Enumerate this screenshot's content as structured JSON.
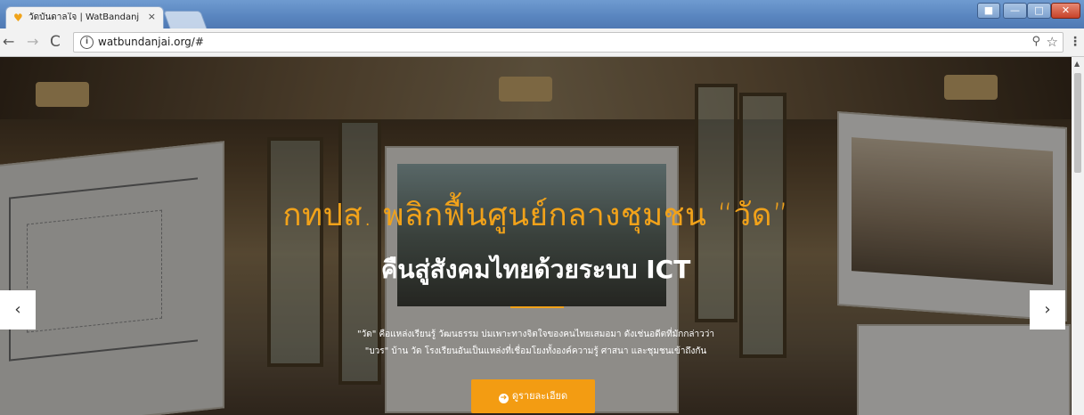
{
  "browser": {
    "tab": {
      "favicon": "heart-icon",
      "title": "วัดบันดาลใจ | WatBandanj",
      "close_glyph": "×"
    },
    "address": {
      "url": "watbundanjai.org/#"
    },
    "icons": [
      "back-arrow-icon",
      "forward-arrow-icon",
      "reload-icon",
      "info-icon",
      "zoom-icon",
      "star-icon",
      "menu-icon"
    ]
  },
  "hero": {
    "headline": "กทปส. พลิกฟื้นศูนย์กลางชุมชน “วัด”",
    "subhead": "คืนสู่สังคมไทยด้วยระบบ ICT",
    "desc_line1": "\"วัด\" คือแหล่งเรียนรู้ วัฒนธรรม บ่มเพาะทางจิตใจของคนไทยเสมอมา ดังเช่นอดีตที่มักกล่าวว่า",
    "desc_line2": "\"บวร\" บ้าน วัด โรงเรียนอันเป็นแหล่งที่เชื่อมโยงทั้งองค์ความรู้ ศาสนา และชุมชนเข้าถึงกัน",
    "cta_label": "ดูรายละเอียด",
    "prev_glyph": "‹",
    "next_glyph": "›"
  },
  "colors": {
    "accent": "#f39c12",
    "headline": "#f1a21a"
  }
}
